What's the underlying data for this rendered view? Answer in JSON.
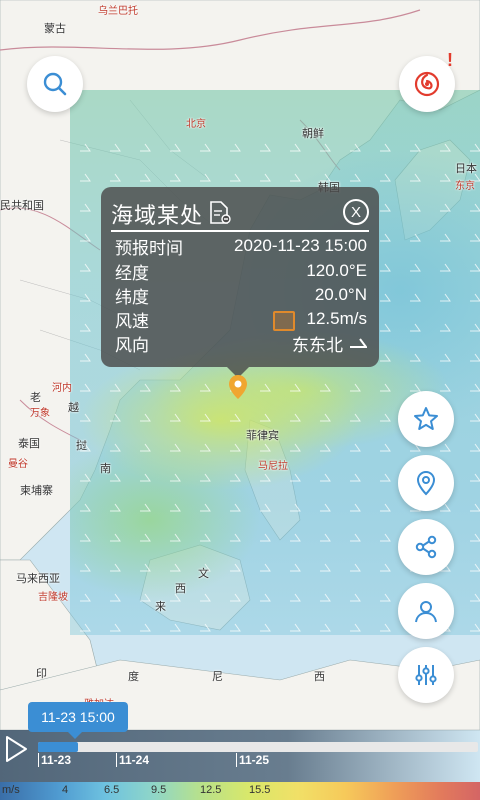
{
  "colors": {
    "accent": "#3b8ed4",
    "alert": "#e23b2d",
    "popup_bg": "#4b4b4b"
  },
  "map": {
    "labels": {
      "wulanbatuo": "乌兰巴托",
      "menggu": "蒙古",
      "beijing": "北京",
      "chaoxian": "朝鲜",
      "hanguo": "韩国",
      "riben": "日本",
      "dongjing": "东京",
      "minzhu": "民共和国",
      "lao": "老",
      "henei": "河内",
      "wanxiang": "万象",
      "yue": "越",
      "taiguo": "泰国",
      "mangu": "曼谷",
      "jianpuzhai": "柬埔寨",
      "zhuo": "挝",
      "nan": "南",
      "feilvbin": "菲律宾",
      "manila": "马尼拉",
      "malaixiya": "马来西亚",
      "jilongpo": "吉隆坡",
      "wen": "文",
      "lai": "来",
      "xi": "西",
      "yin": "印",
      "du": "度",
      "ni": "尼",
      "xi2": "西",
      "yajiada": "雅加达"
    }
  },
  "buttons": {
    "search_icon": "search-icon",
    "typhoon_icon": "typhoon-icon",
    "alert_mark": "!",
    "favorite_icon": "star-icon",
    "location_icon": "location-pin-icon",
    "share_icon": "share-icon",
    "user_icon": "user-icon",
    "settings_icon": "sliders-icon"
  },
  "popup": {
    "title": "海域某处",
    "close": "X",
    "rows": [
      {
        "label": "预报时间",
        "value": "2020-11-23 15:00"
      },
      {
        "label": "经度",
        "value": "120.0°E"
      },
      {
        "label": "纬度",
        "value": "20.0°N"
      },
      {
        "label": "风速",
        "value": "12.5m/s"
      },
      {
        "label": "风向",
        "value": "东东北"
      }
    ]
  },
  "timeline": {
    "current": "11-23 15:00",
    "ticks": [
      "11-23",
      "11-24",
      "11-25"
    ],
    "progress": 0.09
  },
  "legend": {
    "unit": "m/s",
    "values": [
      "4",
      "6.5",
      "9.5",
      "12.5",
      "15.5"
    ]
  }
}
